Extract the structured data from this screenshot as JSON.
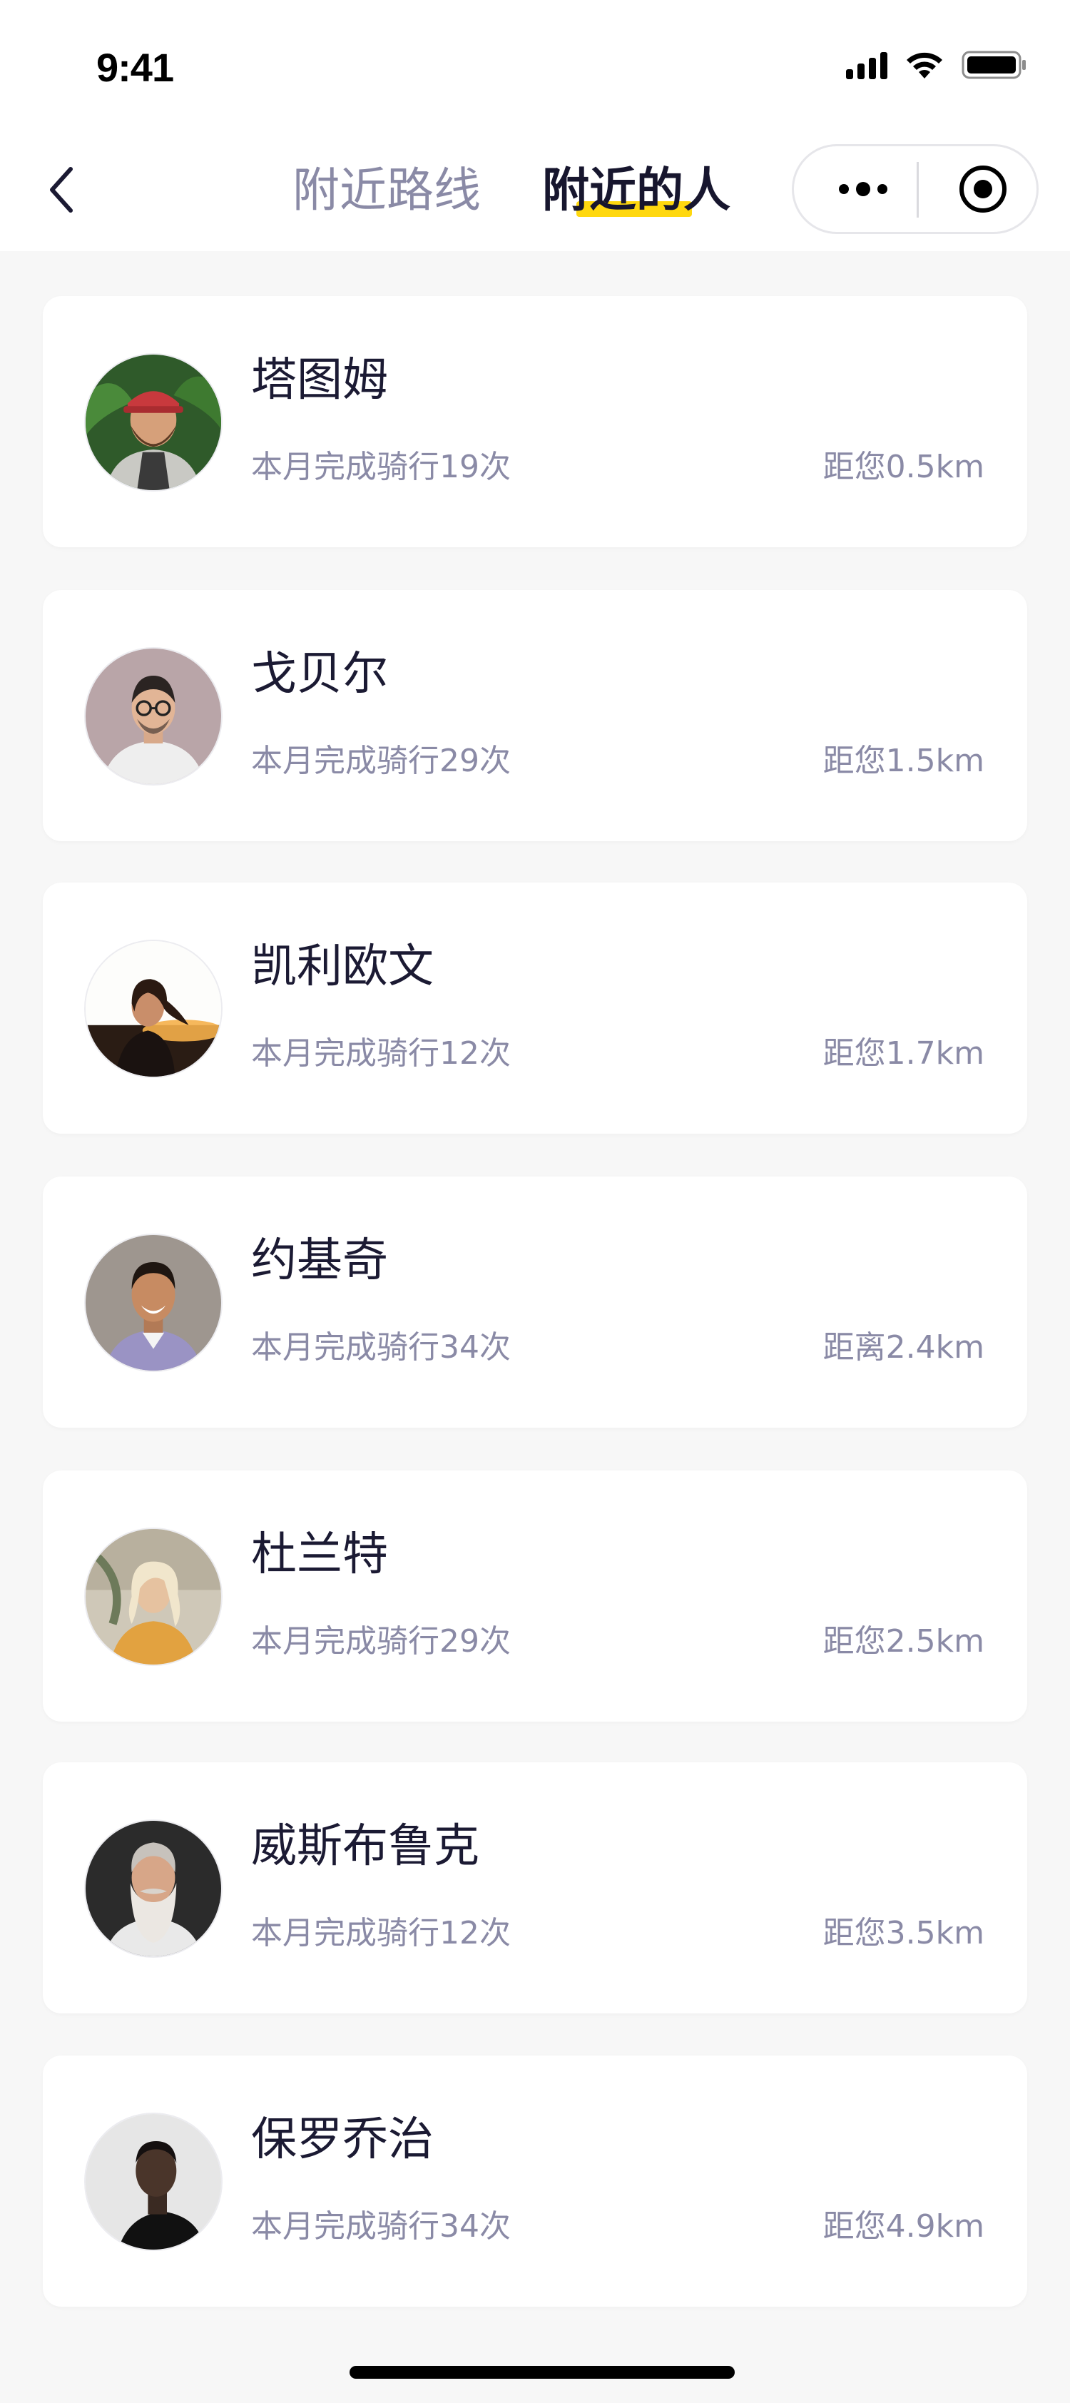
{
  "status_bar": {
    "time": "9:41"
  },
  "nav": {
    "tabs": [
      {
        "label": "附近路线",
        "active": false
      },
      {
        "label": "附近的人",
        "active": true
      }
    ],
    "accent_color": "#ffd80f"
  },
  "icons": {
    "back": "chevron-left-icon",
    "more": "more-dots-icon",
    "target": "target-circle-icon",
    "signal": "signal-icon",
    "wifi": "wifi-icon",
    "battery": "battery-icon"
  },
  "people": [
    {
      "name": "塔图姆",
      "rides": "本月完成骑行19次",
      "distance": "距您0.5km",
      "avatar": "bearded-man-red-cap-avatar"
    },
    {
      "name": "戈贝尔",
      "rides": "本月完成骑行29次",
      "distance": "距您1.5km",
      "avatar": "man-glasses-avatar"
    },
    {
      "name": "凯利欧文",
      "rides": "本月完成骑行12次",
      "distance": "距您1.7km",
      "avatar": "woman-sunset-avatar"
    },
    {
      "name": "约基奇",
      "rides": "本月完成骑行34次",
      "distance": "距离2.4km",
      "avatar": "smiling-man-avatar"
    },
    {
      "name": "杜兰特",
      "rides": "本月完成骑行29次",
      "distance": "距您2.5km",
      "avatar": "blonde-woman-avatar"
    },
    {
      "name": "威斯布鲁克",
      "rides": "本月完成骑行12次",
      "distance": "距您3.5km",
      "avatar": "white-beard-man-avatar"
    },
    {
      "name": "保罗乔治",
      "rides": "本月完成骑行34次",
      "distance": "距您4.9km",
      "avatar": "man-portrait-bw-avatar"
    }
  ]
}
